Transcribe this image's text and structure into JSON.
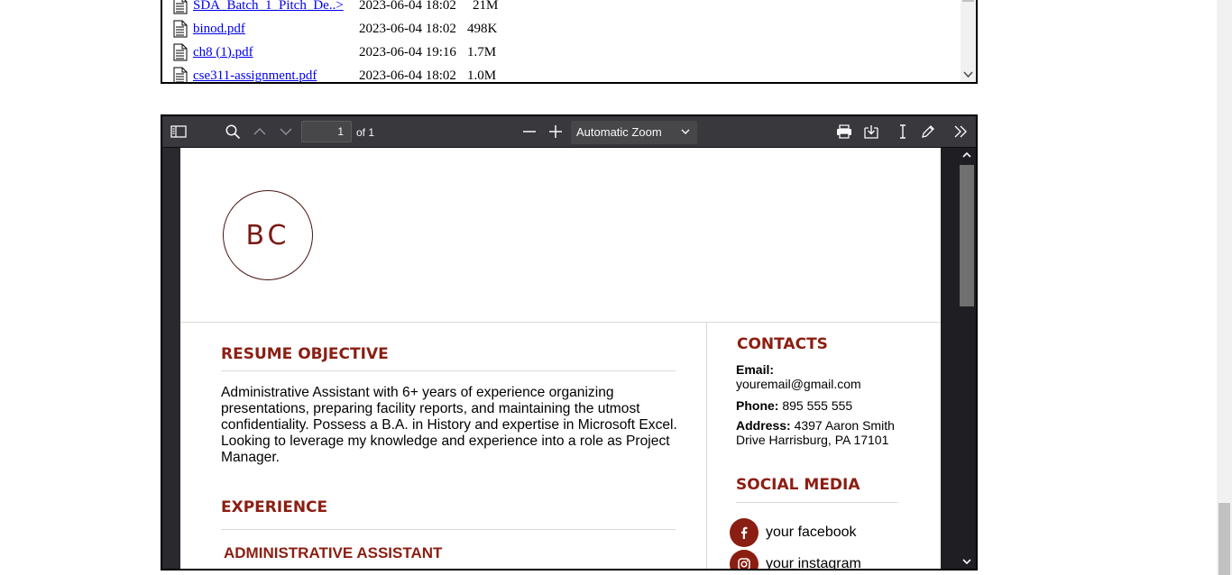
{
  "listing": {
    "files": [
      {
        "name": "SDA_Batch_1_Pitch_De..>",
        "date": "2023-06-04 18:02",
        "size": "21M"
      },
      {
        "name": "binod.pdf",
        "date": "2023-06-04 18:02",
        "size": "498K"
      },
      {
        "name": "ch8 (1).pdf",
        "date": "2023-06-04 19:16",
        "size": "1.7M"
      },
      {
        "name": "cse311-assignment.pdf",
        "date": "2023-06-04 18:02",
        "size": "1.0M"
      }
    ]
  },
  "pdf_viewer": {
    "page_number": "1",
    "page_count_label": "of 1",
    "zoom_label": "Automatic Zoom",
    "icons": {
      "sidebar": "sidebar-toggle-icon",
      "find": "search-icon",
      "prev": "chevron-up-icon",
      "next": "chevron-down-icon",
      "zoom_out": "minus-icon",
      "zoom_in": "plus-icon",
      "print": "printer-icon",
      "save": "download-icon",
      "text_cursor": "text-cursor-icon",
      "draw": "pencil-icon",
      "tools": "double-chevron-right-icon"
    }
  },
  "resume": {
    "monogram": "BC",
    "objective_title": "RESUME OBJECTIVE",
    "objective_text": "Administrative Assistant with 6+ years of experience organizing presentations, preparing facility reports, and maintaining the utmost confidentiality. Possess a B.A. in History and expertise in Microsoft Excel. Looking to leverage my knowledge and experience into a role as Project Manager.",
    "experience_title": "EXPERIENCE",
    "job_title": "ADMINISTRATIVE ASSISTANT",
    "contacts_title": "CONTACTS",
    "email_label": "Email:",
    "email_value": "youremail@gmail.com",
    "phone_label": "Phone:",
    "phone_value": "895 555 555",
    "address_label": "Address:",
    "address_value": "4397 Aaron Smith Drive Harrisburg, PA 17101",
    "social_title": "SOCIAL MEDIA",
    "facebook": "your facebook",
    "instagram": "your instagram"
  },
  "colors": {
    "accent": "#8b1e12",
    "toolbar_bg": "#38383d",
    "link": "#0000ee"
  }
}
